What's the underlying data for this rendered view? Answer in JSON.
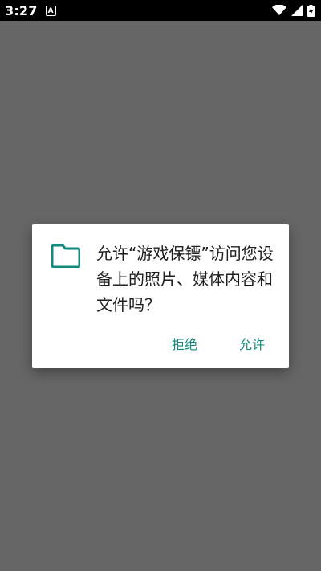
{
  "status_bar": {
    "time": "3:27",
    "notification_icon_letter": "A",
    "icons": [
      "wifi-icon",
      "signal-icon",
      "battery-charging-icon"
    ]
  },
  "dialog": {
    "icon": "folder-icon",
    "message": "允许“游戏保镖”访问您设备上的照片、媒体内容和文件吗？",
    "deny_label": "拒绝",
    "allow_label": "允许"
  },
  "colors": {
    "accent": "#128a7e",
    "scrim": "#666666",
    "status_bar": "#000000"
  }
}
